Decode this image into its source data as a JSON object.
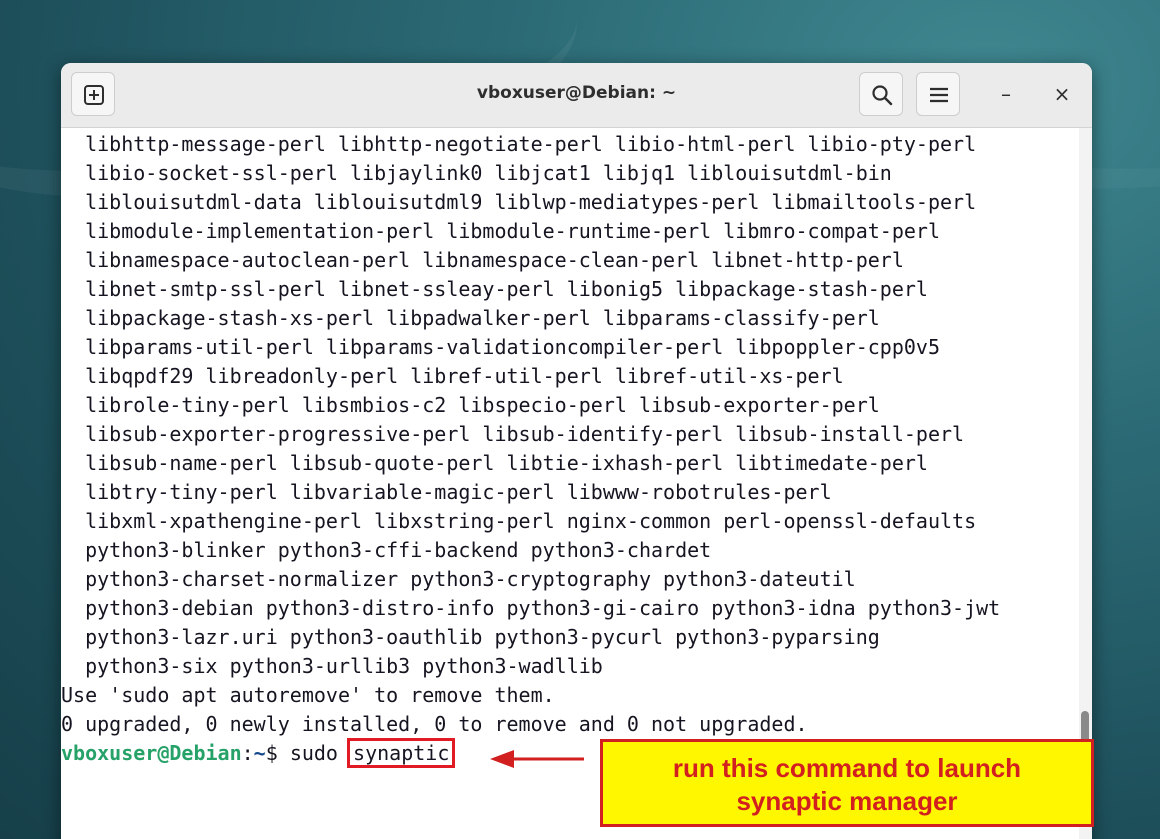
{
  "window": {
    "title": "vboxuser@Debian: ~"
  },
  "icons": {
    "new_tab": "new-tab-icon",
    "search": "search-icon",
    "menu": "hamburger-menu-icon",
    "minimize": "minimize-icon",
    "close": "close-icon"
  },
  "controls": {
    "minimize_glyph": "–",
    "close_glyph": "×"
  },
  "terminal": {
    "lines": [
      "  libhttp-message-perl libhttp-negotiate-perl libio-html-perl libio-pty-perl",
      "  libio-socket-ssl-perl libjaylink0 libjcat1 libjq1 liblouisutdml-bin",
      "  liblouisutdml-data liblouisutdml9 liblwp-mediatypes-perl libmailtools-perl",
      "  libmodule-implementation-perl libmodule-runtime-perl libmro-compat-perl",
      "  libnamespace-autoclean-perl libnamespace-clean-perl libnet-http-perl",
      "  libnet-smtp-ssl-perl libnet-ssleay-perl libonig5 libpackage-stash-perl",
      "  libpackage-stash-xs-perl libpadwalker-perl libparams-classify-perl",
      "  libparams-util-perl libparams-validationcompiler-perl libpoppler-cpp0v5",
      "  libqpdf29 libreadonly-perl libref-util-perl libref-util-xs-perl",
      "  librole-tiny-perl libsmbios-c2 libspecio-perl libsub-exporter-perl",
      "  libsub-exporter-progressive-perl libsub-identify-perl libsub-install-perl",
      "  libsub-name-perl libsub-quote-perl libtie-ixhash-perl libtimedate-perl",
      "  libtry-tiny-perl libvariable-magic-perl libwww-robotrules-perl",
      "  libxml-xpathengine-perl libxstring-perl nginx-common perl-openssl-defaults",
      "  python3-blinker python3-cffi-backend python3-chardet",
      "  python3-charset-normalizer python3-cryptography python3-dateutil",
      "  python3-debian python3-distro-info python3-gi-cairo python3-idna python3-jwt",
      "  python3-lazr.uri python3-oauthlib python3-pycurl python3-pyparsing",
      "  python3-six python3-urllib3 python3-wadllib",
      "Use 'sudo apt autoremove' to remove them.",
      "0 upgraded, 0 newly installed, 0 to remove and 0 not upgraded."
    ],
    "prompt": {
      "user_host": "vboxuser@Debian",
      "separator": ":",
      "path": "~",
      "symbol": "$ ",
      "command_prefix": "sudo ",
      "command_highlight": "synaptic"
    }
  },
  "annotation": {
    "line1": "run this command to launch",
    "line2": "synaptic manager",
    "colors": {
      "background": "#fff700",
      "text": "#d21f1f",
      "border": "#d21f1f"
    }
  },
  "colors": {
    "prompt_user": "#26a269",
    "prompt_path": "#12488b",
    "highlight_box": "#e01b24"
  }
}
